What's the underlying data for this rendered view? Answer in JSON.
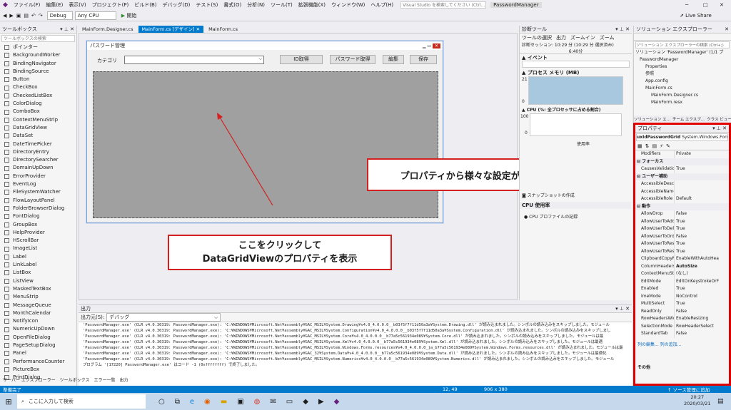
{
  "menu": [
    "ファイル(F)",
    "編集(E)",
    "表示(V)",
    "プロジェクト(P)",
    "ビルド(B)",
    "デバッグ(D)",
    "テスト(S)",
    "書式(O)",
    "分析(N)",
    "ツール(T)",
    "拡張機能(X)",
    "ウィンドウ(W)",
    "ヘルプ(H)"
  ],
  "search_placeholder": "Visual Studio を検索してください (Ctrl...",
  "app_name": "PasswordManager",
  "toolbar": {
    "config": "Debug",
    "platform": "Any CPU",
    "start": "開始",
    "live_share": "Live Share"
  },
  "toolbox": {
    "title": "ツールボックス",
    "search": "ツールボックスの検索",
    "items": [
      "ポインター",
      "BackgroundWorker",
      "BindingNavigator",
      "BindingSource",
      "Button",
      "CheckBox",
      "CheckedListBox",
      "ColorDialog",
      "ComboBox",
      "ContextMenuStrip",
      "DataGridView",
      "DataSet",
      "DateTimePicker",
      "DirectoryEntry",
      "DirectorySearcher",
      "DomainUpDown",
      "ErrorProvider",
      "EventLog",
      "FileSystemWatcher",
      "FlowLayoutPanel",
      "FolderBrowserDialog",
      "FontDialog",
      "GroupBox",
      "HelpProvider",
      "HScrollBar",
      "ImageList",
      "Label",
      "LinkLabel",
      "ListBox",
      "ListView",
      "MaskedTextBox",
      "MenuStrip",
      "MessageQueue",
      "MonthCalendar",
      "NotifyIcon",
      "NumericUpDown",
      "OpenFileDialog",
      "PageSetupDialog",
      "Panel",
      "PerformanceCounter",
      "PictureBox",
      "PrintDialog"
    ]
  },
  "doc_tabs": [
    "MainForm.Designer.cs",
    "MainForm.cs [デザイン]",
    "MainForm.cs"
  ],
  "form": {
    "title": "パスワード管理",
    "category_label": "カテゴリ",
    "btn_id": "ID取得",
    "btn_pw": "パスワード取得",
    "btn_edit": "編集",
    "btn_save": "保存"
  },
  "annotation_props": "プロパティから様々な設定が行える",
  "annotation_grid": [
    "ここをクリックして",
    "DataGridViewのプロパティを表示"
  ],
  "diag": {
    "title": "診断ツール",
    "tools": "ツールの選択",
    "output_btn": "出力",
    "zoom_in": "ズームイン",
    "zoom_out": "ズーム",
    "session": "診断セッション: 10:29 分 (10:29 分 選択済み)",
    "time": "6:40分",
    "events": "イベント",
    "memory": "プロセス メモリ (MB)",
    "mem_max": "21",
    "mem_min": "0",
    "cpu": "CPU (%: 全プロセッサに占める割合)",
    "cpu_max": "100",
    "cpu_min": "0",
    "usage": "使用率",
    "snapshot": "スナップショットの作成",
    "cpu_usage": "CPU 使用率",
    "cpu_profile": "CPU プロファイルの記録"
  },
  "solution": {
    "title": "ソリューション エクスプローラー",
    "search": "ソリューション エクスプローラーの検索 (Ctrl+;)",
    "items": [
      "ソリューション 'PasswordManager' (1/1 プ",
      "PasswordManager",
      "Properties",
      "参照",
      "App.config",
      "MainForm.cs",
      "MainForm.Designer.cs",
      "MainForm.resx"
    ],
    "tabs": [
      "ソリューション エ...",
      "チーム エクスプ...",
      "クラス ビュー"
    ]
  },
  "props": {
    "title": "プロパティ",
    "object": "uxIdPasswordGrid",
    "type": "System.Windows.Forms.",
    "rows": [
      {
        "n": "Modifiers",
        "v": "Private"
      },
      {
        "cat": "フォーカス"
      },
      {
        "n": "CausesValidation",
        "v": "True"
      },
      {
        "cat": "ユーザー補助"
      },
      {
        "n": "AccessibleDescripti",
        "v": ""
      },
      {
        "n": "AccessibleName",
        "v": ""
      },
      {
        "n": "AccessibleRole",
        "v": "Default"
      },
      {
        "cat": "動作"
      },
      {
        "n": "AllowDrop",
        "v": "False"
      },
      {
        "n": "AllowUserToAddRo",
        "v": "True"
      },
      {
        "n": "AllowUserToDelete",
        "v": "True"
      },
      {
        "n": "AllowUserToOrderC",
        "v": "False"
      },
      {
        "n": "AllowUserToResizeC",
        "v": "True"
      },
      {
        "n": "AllowUserToResizeR",
        "v": "True"
      },
      {
        "n": "ClipboardCopyMode",
        "v": "EnableWithAutoHea"
      },
      {
        "n": "ColumnHeadersHe",
        "v": "AutoSize"
      },
      {
        "n": "ContextMenuStrip",
        "v": "(なし)"
      },
      {
        "n": "EditMode",
        "v": "EditOnKeystrokeOrF"
      },
      {
        "n": "Enabled",
        "v": "True"
      },
      {
        "n": "ImeMode",
        "v": "NoControl"
      },
      {
        "n": "MultiSelect",
        "v": "True"
      },
      {
        "n": "ReadOnly",
        "v": "False"
      },
      {
        "n": "RowHeadersWidthS",
        "v": "EnableResizing"
      },
      {
        "n": "SelectionMode",
        "v": "RowHeaderSelect"
      },
      {
        "n": "StandardTab",
        "v": "False"
      }
    ],
    "links": "列の編集... 列の追加...",
    "other": "その他"
  },
  "output": {
    "title": "出力",
    "source_label": "出力元(S):",
    "source": "デバッグ",
    "lines": [
      "'PasswordManager.exe' (CLR v4.0.30319: PasswordManager.exe): 'C:¥WINDOWS¥Microsoft.Net¥assembly¥GAC_MSIL¥System.Drawing¥v4.0_4.0.0.0__b03f5f7f11d50a3a¥System.Drawing.dll' が読み込まれました。シンボルの読み込みをスキップしました。モジュール",
      "'PasswordManager.exe' (CLR v4.0.30319: PasswordManager.exe): 'C:¥WINDOWS¥Microsoft.Net¥assembly¥GAC_MSIL¥System.Configuration¥v4.0_4.0.0.0__b03f5f7f11d50a3a¥System.Configuration.dll' が読み込まれました。シンボルの読み込みをスキップしまし",
      "'PasswordManager.exe' (CLR v4.0.30319: PasswordManager.exe): 'C:¥WINDOWS¥Microsoft.Net¥assembly¥GAC_MSIL¥System.Core¥v4.0_4.0.0.0__b77a5c561934e089¥System.Core.dll' が読み込まれました。シンボルの読み込みをスキップしました。モジュールは最",
      "'PasswordManager.exe' (CLR v4.0.30319: PasswordManager.exe): 'C:¥WINDOWS¥Microsoft.Net¥assembly¥GAC_MSIL¥System.Xml¥v4.0_4.0.0.0__b77a5c561934e089¥System.Xml.dll' が読み込まれました。シンボルの読み込みをスキップしました。モジュールは最適",
      "'PasswordManager.exe' (CLR v4.0.30319: PasswordManager.exe): 'C:¥WINDOWS¥Microsoft.Net¥assembly¥GAC_MSIL¥System.Windows.Forms.resources¥v4.0_4.0.0.0_ja_b77a5c561934e089¥System.Windows.Forms.resources.dll' が読み込まれました。モジュールは最",
      "'PasswordManager.exe' (CLR v4.0.30319: PasswordManager.exe): 'C:¥WINDOWS¥Microsoft.Net¥assembly¥GAC_32¥System.Data¥v4.0_4.0.0.0__b77a5c561934e089¥System.Data.dll' が読み込まれました。シンボルの読み込みをスキップしました。モジュールは最適化",
      "'PasswordManager.exe' (CLR v4.0.30319: PasswordManager.exe): 'C:¥WINDOWS¥Microsoft.Net¥assembly¥GAC_MSIL¥System.Numerics¥v4.0_4.0.0.0__b77a5c561934e089¥System.Numerics.dll' が読み込まれました。シンボルの読み込みをスキップしました。モジュール",
      "プログラム '[17220] PasswordManager.exe' はコード -1 (0xffffffff) で終了しました。"
    ]
  },
  "bottom_tabs": [
    "サーバー エクスプローラー",
    "ツールボックス",
    "エラー一覧",
    "出力"
  ],
  "status": {
    "ready": "準備完了",
    "pos": "12, 49",
    "size": "906 x 380",
    "scm": "ソース管理に追加"
  },
  "taskbar": {
    "search": "ここに入力して検索",
    "time": "20:27",
    "date": "2020/03/21"
  }
}
